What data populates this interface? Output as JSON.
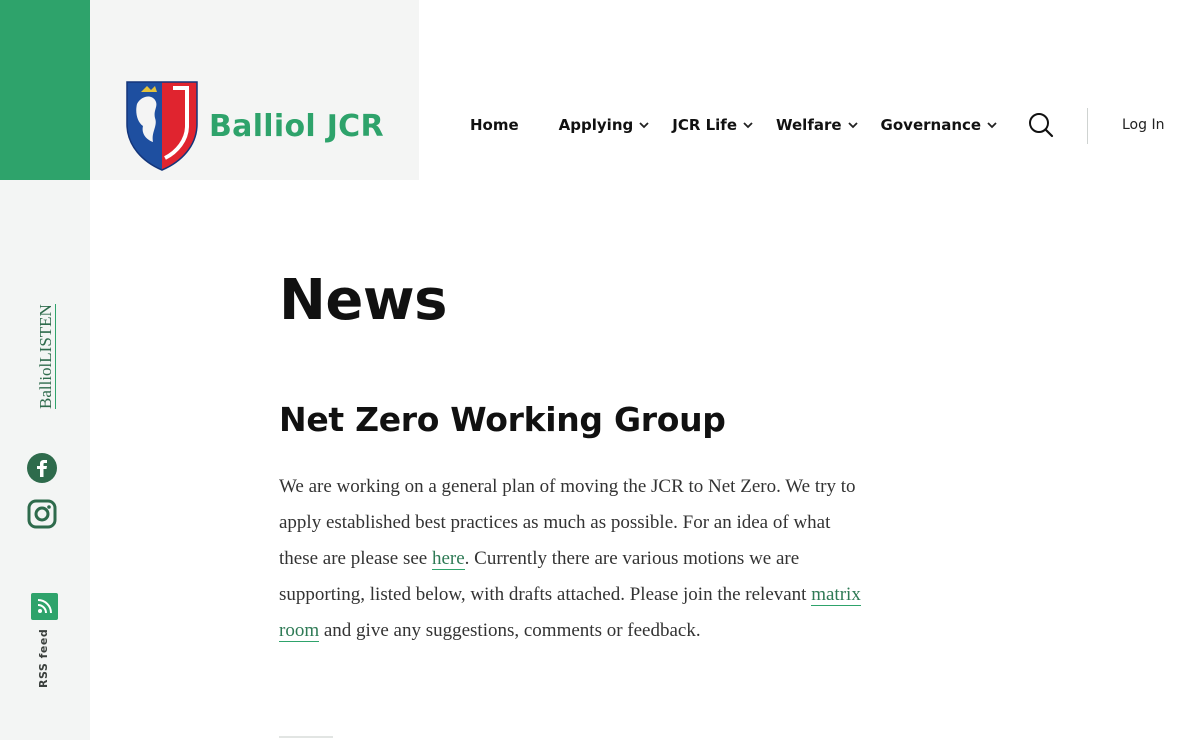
{
  "brand": {
    "name": "Balliol JCR",
    "logo": "balliol-crest"
  },
  "nav": {
    "items": [
      {
        "label": "Home",
        "has_dropdown": false
      },
      {
        "label": "Applying",
        "has_dropdown": true
      },
      {
        "label": "JCR Life",
        "has_dropdown": true
      },
      {
        "label": "Welfare",
        "has_dropdown": true
      },
      {
        "label": "Governance",
        "has_dropdown": true
      }
    ],
    "search_icon": "search-icon",
    "login_label": "Log In"
  },
  "sidebar": {
    "listen_label": "BalliolLISTEN",
    "social_icons": [
      "facebook-icon",
      "instagram-icon"
    ],
    "rss_icon": "rss-icon",
    "rss_label": "RSS feed"
  },
  "main": {
    "page_title": "News",
    "post": {
      "title": "Net Zero Working Group",
      "body_before_link1": "We are working on a general plan of moving the JCR to Net Zero. We try to apply established best practices as much as possible. For an idea of what these are please see ",
      "link1": "here",
      "body_between": ". Currently there are various motions we are supporting, listed below, with drafts attached. Please join the relevant ",
      "link2": "matrix room",
      "body_after": " and give any suggestions, comments or feedback."
    }
  },
  "colors": {
    "accent": "#2ea36b",
    "rail": "#f3f5f4",
    "text": "#111111"
  }
}
